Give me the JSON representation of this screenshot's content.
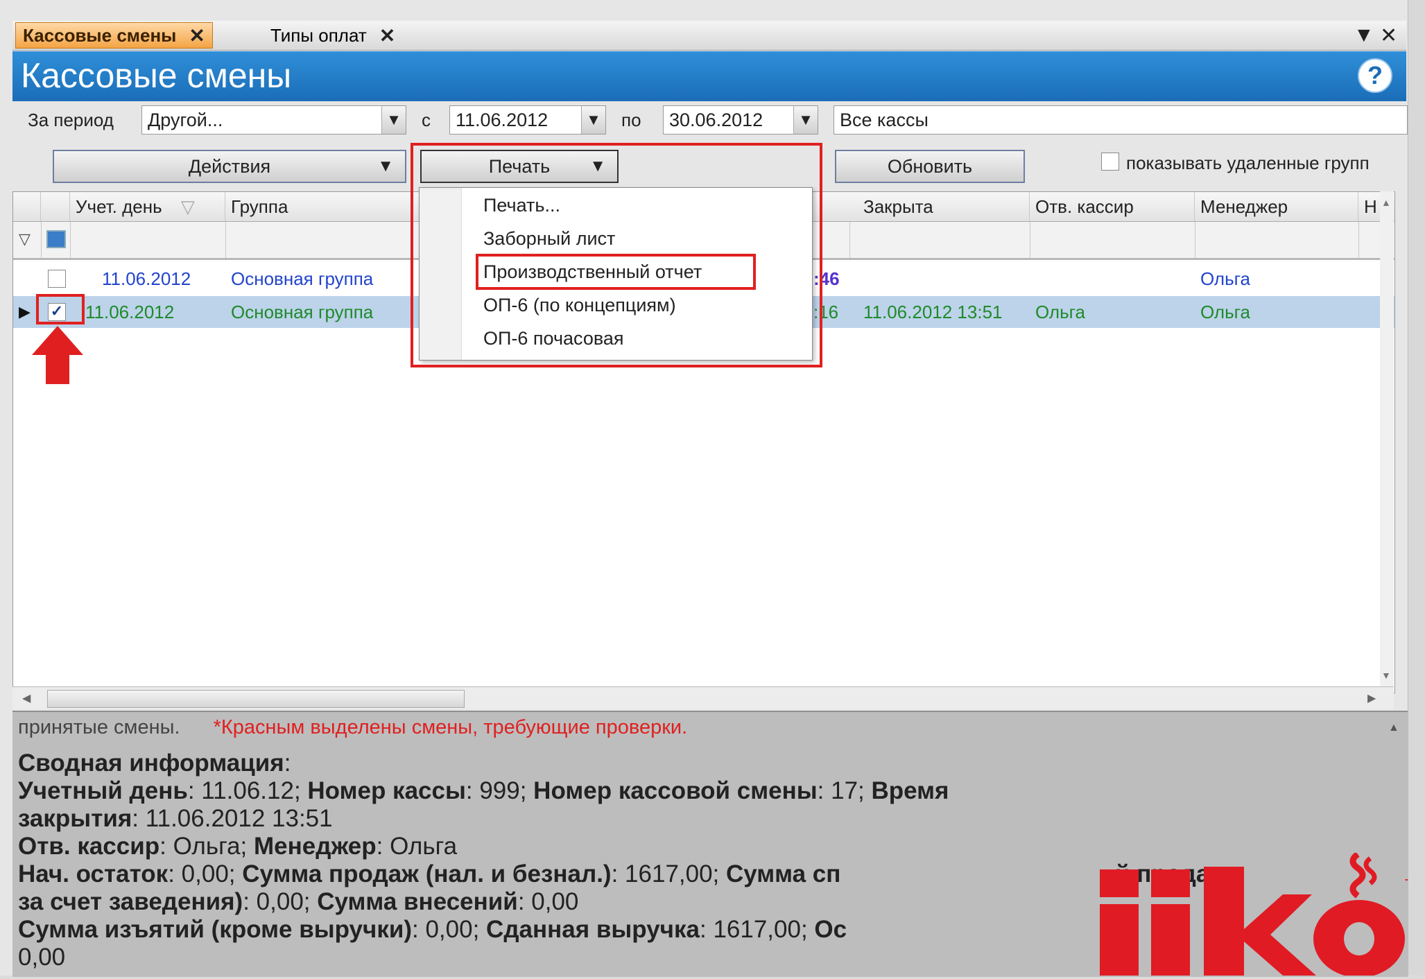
{
  "tabs": [
    {
      "label": "Кассовые смены",
      "close": "✕"
    },
    {
      "label": "Типы оплат",
      "close": "✕"
    }
  ],
  "title": "Кассовые смены",
  "help": "?",
  "filters": {
    "period_label": "За период",
    "period_value": "Другой...",
    "from_label": "с",
    "from_value": "11.06.2012",
    "to_label": "по",
    "to_value": "30.06.2012",
    "registers_value": "Все кассы"
  },
  "toolbar": {
    "actions": "Действия",
    "print": "Печать",
    "refresh": "Обновить",
    "show_deleted": "показывать удаленные групп"
  },
  "print_menu": [
    "Печать...",
    "Заборный лист",
    "Производственный отчет",
    "ОП-6 (по концепциям)",
    "ОП-6 почасовая"
  ],
  "columns": {
    "day": "Учет. день",
    "group": "Группа",
    "closed": "Закрыта",
    "cashier": "Отв. кассир",
    "manager": "Менеджер",
    "more": "Н"
  },
  "rows": [
    {
      "day": "11.06.2012",
      "group": "Основная группа",
      "opened_tail": ":46",
      "closed": "",
      "cashier": "",
      "manager": "Ольга",
      "checked": false
    },
    {
      "day": "11.06.2012",
      "group": "Основная группа",
      "opened_tail": ":16",
      "closed": "11.06.2012 13:51",
      "cashier": "Ольга",
      "manager": "Ольга",
      "checked": true
    }
  ],
  "summary": {
    "line0_a": "принятые смены.",
    "line0_b": "*Красным выделены смены, требующие проверки.",
    "heading": "Сводная информация",
    "l1_k1": "Учетный день",
    "l1_v1": ": 11.06.12; ",
    "l1_k2": "Номер кассы",
    "l1_v2": ": 999; ",
    "l1_k3": "Номер кассовой смены",
    "l1_v3": ": 17; ",
    "l1_k4": "Время",
    "l2_k": "закрытия",
    "l2_v": ": 11.06.2012 13:51",
    "l3_k1": "Отв. кассир",
    "l3_v1": ": Ольга; ",
    "l3_k2": "Менеджер",
    "l3_v2": ": Ольга",
    "l4_k1": "Нач. остаток",
    "l4_v1": ": 0,00; ",
    "l4_k2": "Сумма продаж (нал. и безнал.)",
    "l4_v2": ": 1617,00; ",
    "l4_k3": "Сумма сп",
    "l4_tail": "й продаж",
    "l5_k1": "за счет заведения)",
    "l5_v1": ": 0,00; ",
    "l5_k2": "Сумма внесений",
    "l5_v2": ": 0,00",
    "l6_k1": "Сумма изъятий (кроме выручки)",
    "l6_v1": ": 0,00; ",
    "l6_k2": "Сданная выручка",
    "l6_v2": ": 1617,00; ",
    "l6_k3": "Ос",
    "l7": "0,00"
  },
  "logo": {
    "text": "iiko",
    "tm": "TM",
    "color": "#e01b24"
  },
  "accent": {
    "title_blue": "#1b6db8",
    "tab_orange": "#f4a445",
    "highlight_red": "#e02020"
  }
}
